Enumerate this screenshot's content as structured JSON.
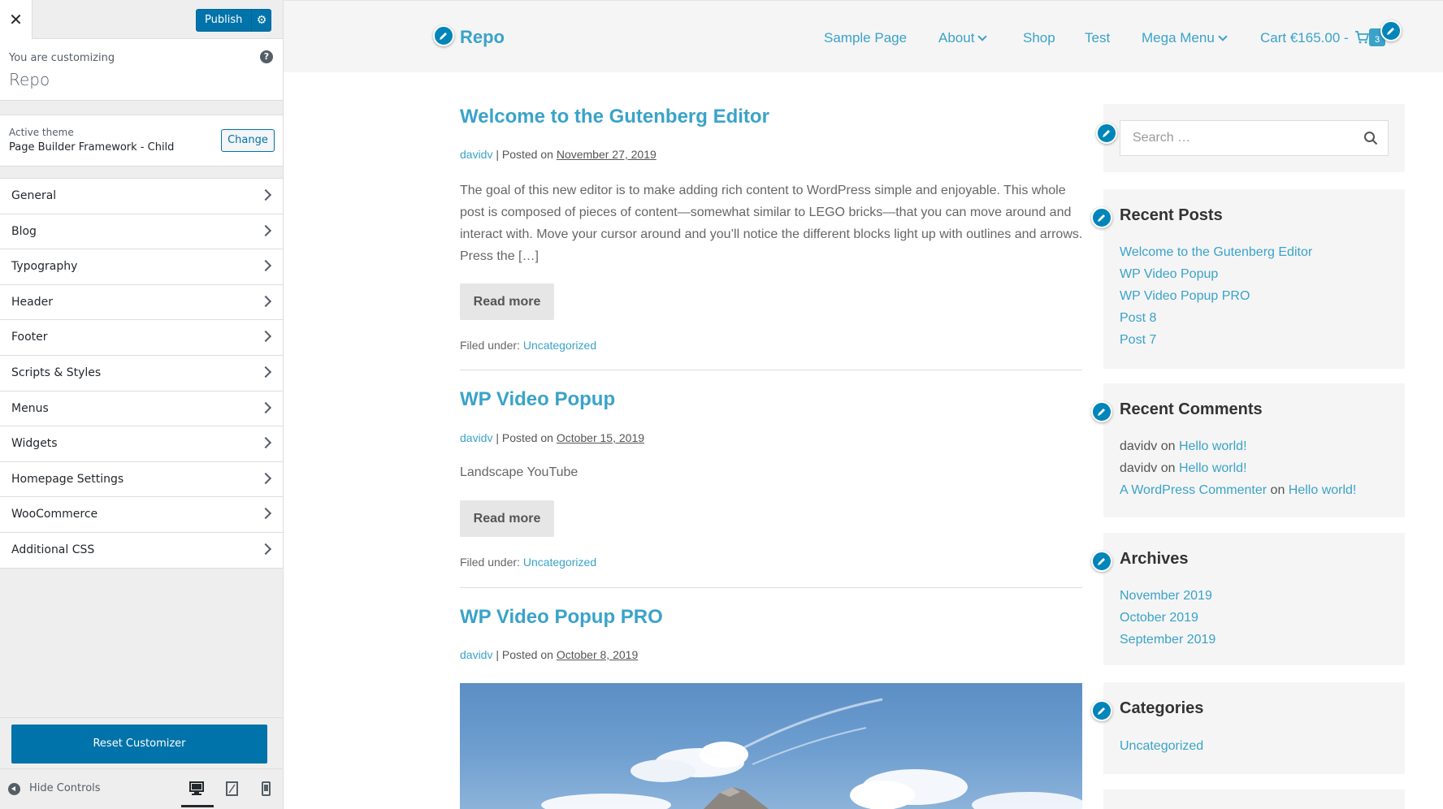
{
  "customizer": {
    "close_icon": "close-icon",
    "publish_label": "Publish",
    "you_are_customizing": "You are customizing",
    "site_name": "Repo",
    "active_theme_label": "Active theme",
    "theme_name": "Page Builder Framework - Child",
    "change_label": "Change",
    "sections": [
      {
        "label": "General"
      },
      {
        "label": "Blog"
      },
      {
        "label": "Typography"
      },
      {
        "label": "Header"
      },
      {
        "label": "Footer"
      },
      {
        "label": "Scripts & Styles"
      },
      {
        "label": "Menus"
      },
      {
        "label": "Widgets"
      },
      {
        "label": "Homepage Settings"
      },
      {
        "label": "WooCommerce"
      },
      {
        "label": "Additional CSS"
      }
    ],
    "reset_label": "Reset Customizer",
    "hide_controls_label": "Hide Controls",
    "accent_color": "#0073aa"
  },
  "site": {
    "logo": "Repo",
    "link_color": "#3aa3c9",
    "nav": {
      "sample_page": "Sample Page",
      "about": "About",
      "shop": "Shop",
      "test": "Test",
      "mega_menu": "Mega Menu",
      "cart": "Cart €165.00 -",
      "cart_count": "3"
    },
    "posts": [
      {
        "title": "Welcome to the Gutenberg Editor",
        "author": "davidv",
        "posted_on": " | Posted on ",
        "date": "November 27, 2019",
        "excerpt": "The goal of this new editor is to make adding rich content to WordPress simple and enjoyable. This whole post is composed of pieces of content—somewhat similar to LEGO bricks—that you can move around and interact with. Move your cursor around and you’ll notice the different blocks light up with outlines and arrows. Press the […]",
        "read_more": "Read more",
        "filed_under": "Filed under: ",
        "category": "Uncategorized"
      },
      {
        "title": "WP Video Popup",
        "author": "davidv",
        "posted_on": " | Posted on ",
        "date": "October 15, 2019",
        "excerpt": "Landscape YouTube",
        "read_more": "Read more",
        "filed_under": "Filed under: ",
        "category": "Uncategorized"
      },
      {
        "title": "WP Video Popup PRO",
        "author": "davidv",
        "posted_on": " | Posted on ",
        "date": "October 8, 2019"
      }
    ],
    "sidebar": {
      "search_placeholder": "Search …",
      "recent_posts_title": "Recent Posts",
      "recent_posts": [
        "Welcome to the Gutenberg Editor",
        "WP Video Popup",
        "WP Video Popup PRO",
        "Post 8",
        "Post 7"
      ],
      "recent_comments_title": "Recent Comments",
      "recent_comments": [
        {
          "author": "davidv",
          "on": " on ",
          "post": "Hello world!"
        },
        {
          "author": "davidv",
          "on": " on ",
          "post": "Hello world!"
        },
        {
          "author": "A WordPress Commenter",
          "on": " on ",
          "post": "Hello world!"
        }
      ],
      "archives_title": "Archives",
      "archives": [
        "November 2019",
        "October 2019",
        "September 2019"
      ],
      "categories_title": "Categories",
      "categories": [
        "Uncategorized"
      ]
    }
  }
}
